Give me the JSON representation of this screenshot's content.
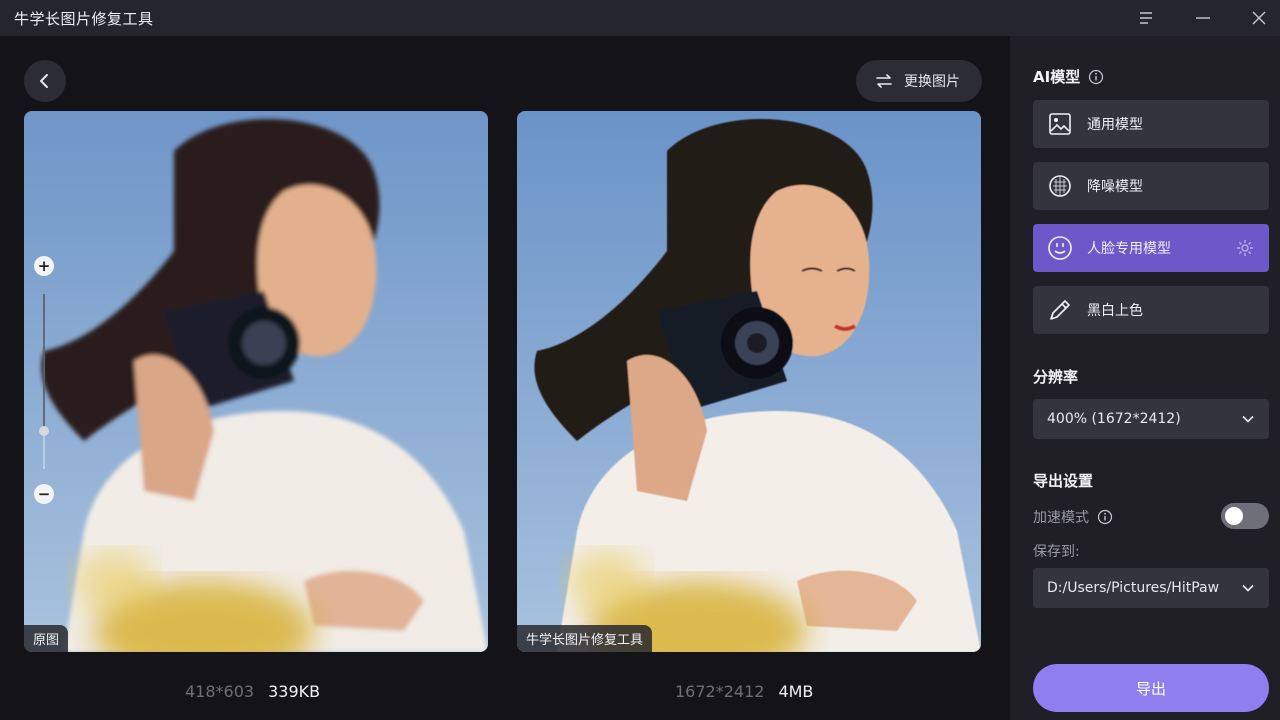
{
  "app": {
    "title": "牛学长图片修复工具"
  },
  "toolbar": {
    "replace_label": "更换图片"
  },
  "images": {
    "original": {
      "tag": "原图",
      "dimensions": "418*603",
      "size": "339KB"
    },
    "enhanced": {
      "tag": "牛学长图片修复工具",
      "dimensions": "1672*2412",
      "size": "4MB"
    }
  },
  "zoom": {
    "level_fraction": 0.22
  },
  "sidebar": {
    "ai_model": {
      "title": "AI模型",
      "models": [
        {
          "label": "通用模型",
          "icon": "image-icon",
          "active": false
        },
        {
          "label": "降噪模型",
          "icon": "denoise-icon",
          "active": false
        },
        {
          "label": "人脸专用模型",
          "icon": "face-icon",
          "active": true
        },
        {
          "label": "黑白上色",
          "icon": "colorize-icon",
          "active": false
        }
      ]
    },
    "resolution": {
      "title": "分辨率",
      "value": "400% (1672*2412)"
    },
    "export_settings": {
      "title": "导出设置",
      "accelerate_label": "加速模式",
      "accelerate_on": false,
      "save_to_label": "保存到:",
      "save_path": "D:/Users/Pictures/HitPaw"
    },
    "export_label": "导出"
  },
  "colors": {
    "accent": "#6c58c8",
    "export_button": "#8f7ef0",
    "panel_bg": "#1f1f25",
    "canvas_bg": "#141418"
  }
}
